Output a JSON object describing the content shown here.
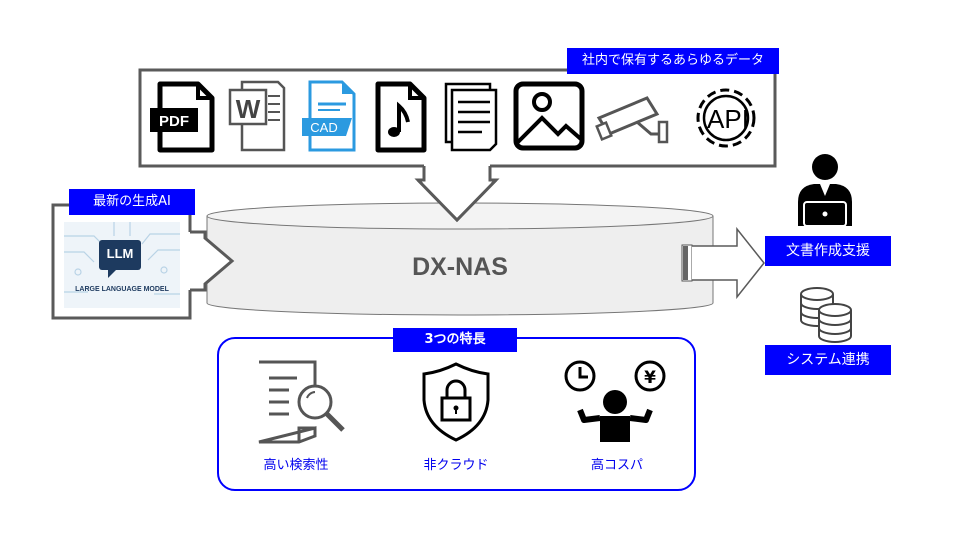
{
  "data_sources": {
    "label": "社内で保有するあらゆるデータ",
    "icons": [
      {
        "name": "pdf-file-icon",
        "text": "PDF"
      },
      {
        "name": "word-file-icon",
        "text": "W"
      },
      {
        "name": "cad-file-icon",
        "text": "CAD"
      },
      {
        "name": "music-file-icon",
        "text": ""
      },
      {
        "name": "documents-icon",
        "text": ""
      },
      {
        "name": "image-icon",
        "text": ""
      },
      {
        "name": "security-camera-icon",
        "text": ""
      },
      {
        "name": "api-gear-icon",
        "text": "API"
      }
    ]
  },
  "llm": {
    "label": "最新の生成AI",
    "badge": "LLM",
    "caption": "LARGE LANGUAGE MODEL"
  },
  "nas": {
    "title": "DX-NAS"
  },
  "outputs": [
    {
      "label": "文書作成支援",
      "icon": "person-laptop-icon"
    },
    {
      "label": "システム連携",
      "icon": "database-icon"
    }
  ],
  "features": {
    "title": "3つの特長",
    "items": [
      {
        "label": "高い検索性",
        "icon": "document-search-icon"
      },
      {
        "label": "非クラウド",
        "icon": "shield-lock-icon"
      },
      {
        "label": "高コスパ",
        "icon": "time-money-person-icon"
      }
    ]
  },
  "colors": {
    "accent": "#0000ff",
    "outline": "#555555",
    "cad_blue": "#2b9ae0"
  }
}
